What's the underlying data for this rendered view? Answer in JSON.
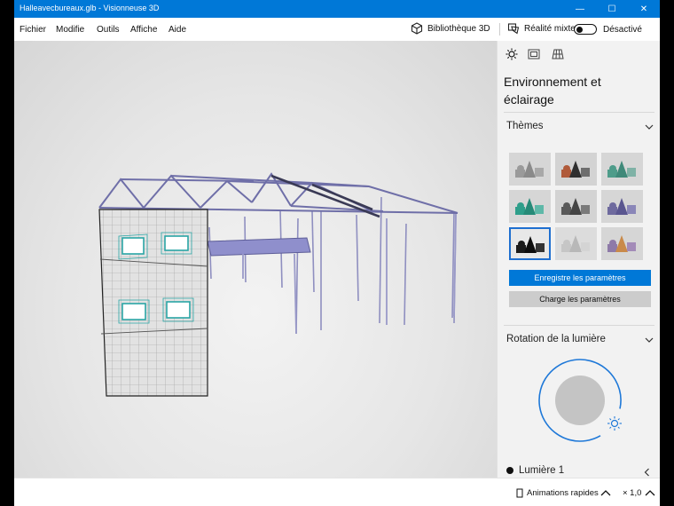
{
  "window": {
    "title": "Halleavecbureaux.glb - Visionneuse 3D"
  },
  "titlebar": {
    "minimize_glyph": "—",
    "maximize_glyph": "☐",
    "close_glyph": "✕"
  },
  "menu": {
    "items": [
      "Fichier",
      "Modifie",
      "Outils",
      "Affiche",
      "Aide"
    ],
    "library_label": "Bibliothèque 3D",
    "mixed_reality_label": "Réalité mixte",
    "mixed_reality_state": "Désactivé"
  },
  "panel": {
    "tabs": [
      "sun-icon",
      "environment-icon",
      "grid-icon"
    ],
    "title": "Environnement et éclairage",
    "themes_label": "Thèmes",
    "themes": [
      {
        "bg": "#d6d6d6",
        "c1": "#9a9a9a",
        "c2": "#8a8a8a",
        "c3": "#a8a8a8"
      },
      {
        "bg": "#d3d3d3",
        "c1": "#b05a3a",
        "c2": "#2f2f2f",
        "c3": "#6d6d6d"
      },
      {
        "bg": "#d6d6d6",
        "c1": "#4e9c8a",
        "c2": "#3f8979",
        "c3": "#7fb2a6"
      },
      {
        "bg": "#d6d6d6",
        "c1": "#2e9e8a",
        "c2": "#268a78",
        "c3": "#5eb8a8"
      },
      {
        "bg": "#d3d3d3",
        "c1": "#5a5a5a",
        "c2": "#444444",
        "c3": "#7a7a7a"
      },
      {
        "bg": "#d6d6d6",
        "c1": "#6e6a9e",
        "c2": "#5a5690",
        "c3": "#8a86b8"
      },
      {
        "bg": "#e8e8e8",
        "c1": "#1a1a1a",
        "c2": "#0d0d0d",
        "c3": "#333333"
      },
      {
        "bg": "#dcdcdc",
        "c1": "#c6c6c6",
        "c2": "#b8b8b8",
        "c3": "#d4d4d4"
      },
      {
        "bg": "#d6d6d6",
        "c1": "#8e7aa8",
        "c2": "#c98a4a",
        "c3": "#a38bb8"
      }
    ],
    "selected_theme_index": 6,
    "save_button": "Enregistre les paramètres",
    "load_button": "Charge les paramètres",
    "rotation_label": "Rotation de la lumière",
    "light1_label": "Lumière 1"
  },
  "status": {
    "animations_label": "Animations rapides",
    "zoom": "× 1,0"
  },
  "colors": {
    "accent": "#0078d7",
    "structure": "#6f6fa8",
    "panel_bg": "#f2f2f2"
  }
}
